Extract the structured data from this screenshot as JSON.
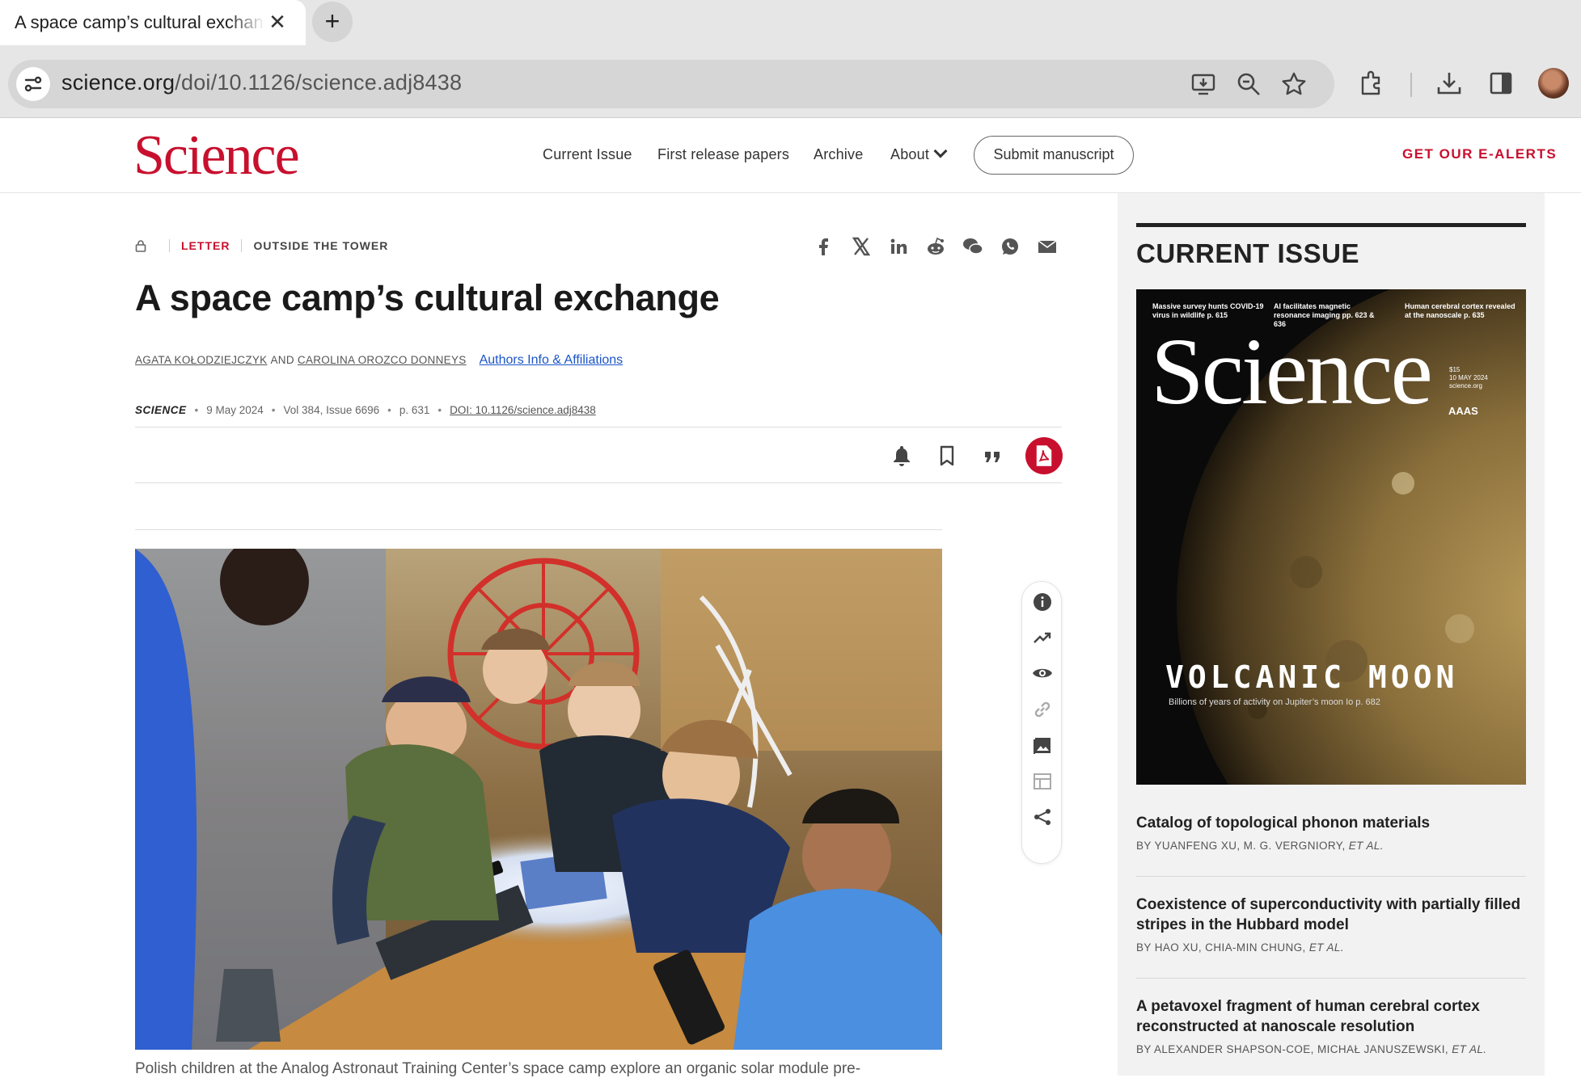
{
  "browser": {
    "tab_title": "A space camp’s cultural exchange",
    "tab_close": "✕",
    "new_tab": "+",
    "url_host": "science.org",
    "url_path": "/doi/10.1126/science.adj8438"
  },
  "header": {
    "logo": "Science",
    "nav": [
      "Current Issue",
      "First release papers",
      "Archive",
      "About"
    ],
    "submit": "Submit manuscript",
    "ealerts": "GET OUR E-ALERTS"
  },
  "article": {
    "category": "LETTER",
    "section": "OUTSIDE THE TOWER",
    "title": "A space camp’s cultural exchange",
    "author1": "AGATA KOŁODZIEJCZYK",
    "and": "AND",
    "author2": "CAROLINA OROZCO DONNEYS",
    "affiliations": "Authors Info & Affiliations",
    "journal": "SCIENCE",
    "date": "9 May 2024",
    "volume": "Vol 384, Issue 6696",
    "page": "p. 631",
    "doi": "DOI: 10.1126/science.adj8438",
    "caption": "Polish children at the Analog Astronaut Training Center’s space camp explore an organic solar module pre-"
  },
  "sidebar": {
    "title": "CURRENT ISSUE",
    "cover": {
      "logo": "Science",
      "top1": "Massive survey hunts COVID-19 virus in wildlife p. 615",
      "top2": "AI facilitates magnetic resonance imaging pp. 623 & 636",
      "top3": "Human cerebral cortex revealed at the nanoscale p. 635",
      "price": "$15\n10 MAY 2024\nscience.org",
      "aaas": "AAAS",
      "headline": "VOLCANIC MOON",
      "sub": "Billions of years of activity on Jupiter’s moon Io p. 682"
    },
    "articles": [
      {
        "title": "Catalog of topological phonon materials",
        "by": "BY YUANFENG XU,  M. G. VERGNIORY, ",
        "etal": "ET AL."
      },
      {
        "title": "Coexistence of superconductivity with partially filled stripes in the Hubbard model",
        "by": "BY HAO XU,  CHIA-MIN CHUNG, ",
        "etal": "ET AL."
      },
      {
        "title": "A petavoxel fragment of human cerebral cortex reconstructed at nanoscale resolution",
        "by": "BY ALEXANDER SHAPSON-COE,  MICHAŁ JANUSZEWSKI, ",
        "etal": "ET AL."
      }
    ]
  },
  "colors": {
    "brand": "#c8102e",
    "link": "#1a55c8"
  }
}
